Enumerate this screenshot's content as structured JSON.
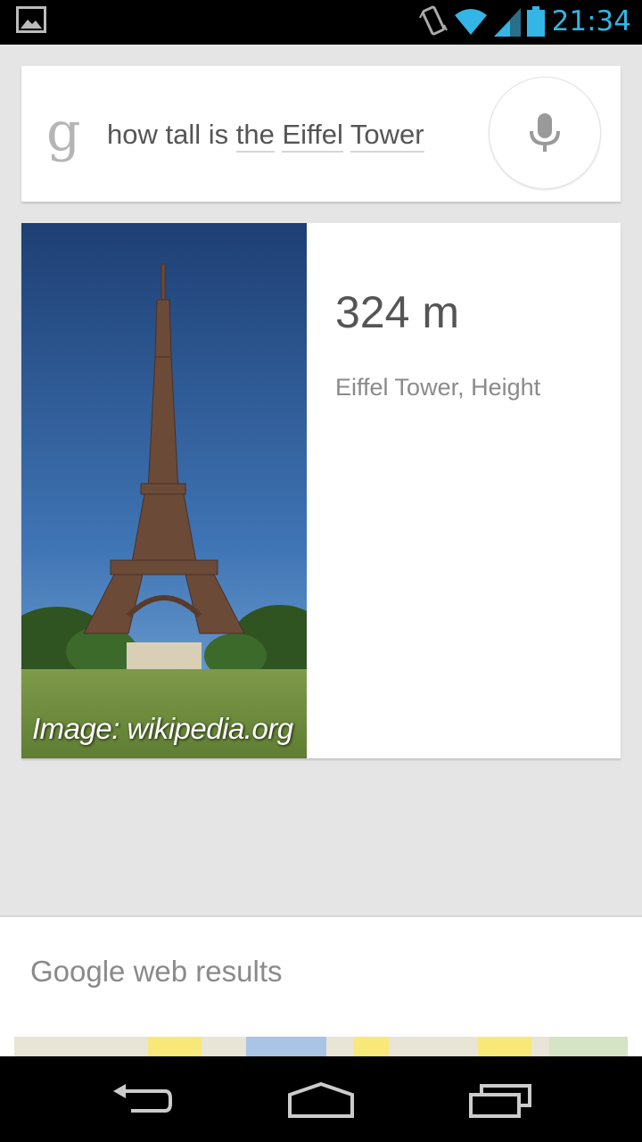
{
  "status_bar": {
    "time": "21:34",
    "icons": [
      "image-notification-icon",
      "vibrate-icon",
      "wifi-icon",
      "signal-icon",
      "battery-icon"
    ],
    "accent_color": "#33b5e5"
  },
  "search": {
    "logo": "g",
    "query_plain": "how tall is ",
    "query_underlined": [
      "the",
      "Eiffel",
      "Tower"
    ],
    "mic_icon": "microphone-icon"
  },
  "answer": {
    "value": "324 m",
    "label": "Eiffel Tower, Height",
    "image_credit": "Image: wikipedia.org"
  },
  "web_results": {
    "title": "Google web results"
  },
  "nav": {
    "buttons": [
      "back-icon",
      "home-icon",
      "recent-apps-icon"
    ]
  }
}
